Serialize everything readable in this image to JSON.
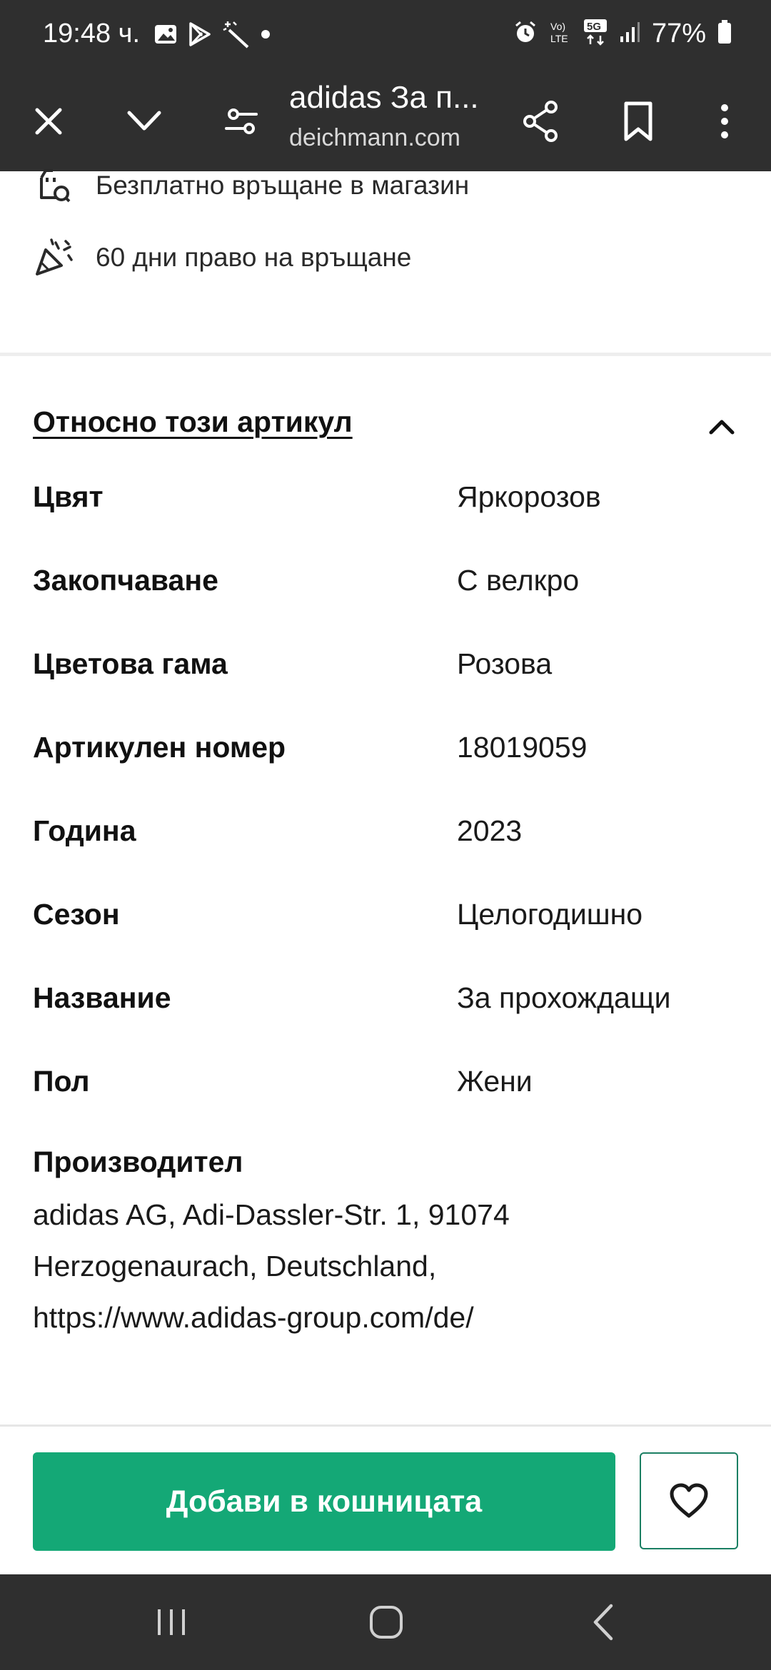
{
  "status_bar": {
    "time": "19:48 ч.",
    "battery": "77%",
    "icons_left": [
      "gallery-icon",
      "play-store-icon",
      "magic-wand-icon",
      "dot-icon"
    ],
    "icons_right": [
      "alarm-icon",
      "volte-icon",
      "5g-icon",
      "signal-icon",
      "battery-icon"
    ]
  },
  "browser": {
    "title": "adidas За п...",
    "url": "deichmann.com"
  },
  "benefits": [
    {
      "icon": "store-return-icon",
      "text": "Безплатно връщане в магазин"
    },
    {
      "icon": "confetti-icon",
      "text": "60 дни право на връщане"
    }
  ],
  "about": {
    "title": "Относно този артикул",
    "rows": [
      {
        "key": "Цвят",
        "value": "Яркорозов"
      },
      {
        "key": "Закопчаване",
        "value": "С велкро"
      },
      {
        "key": "Цветова гама",
        "value": "Розова"
      },
      {
        "key": "Артикулен номер",
        "value": "18019059"
      },
      {
        "key": "Година",
        "value": "2023"
      },
      {
        "key": "Сезон",
        "value": "Целогодишно"
      },
      {
        "key": "Название",
        "value": "За прохождащи"
      },
      {
        "key": "Пол",
        "value": "Жени"
      }
    ],
    "manufacturer_label": "Производител",
    "manufacturer_lines": [
      "adidas AG, Adi-Dassler-Str. 1, 91074",
      "Herzogenaurach, Deutschland,",
      "https://www.adidas-group.com/de/"
    ]
  },
  "actions": {
    "add_to_cart": "Добави в кошницата"
  },
  "colors": {
    "accent": "#14a876",
    "topbar": "#2f2f2f"
  }
}
